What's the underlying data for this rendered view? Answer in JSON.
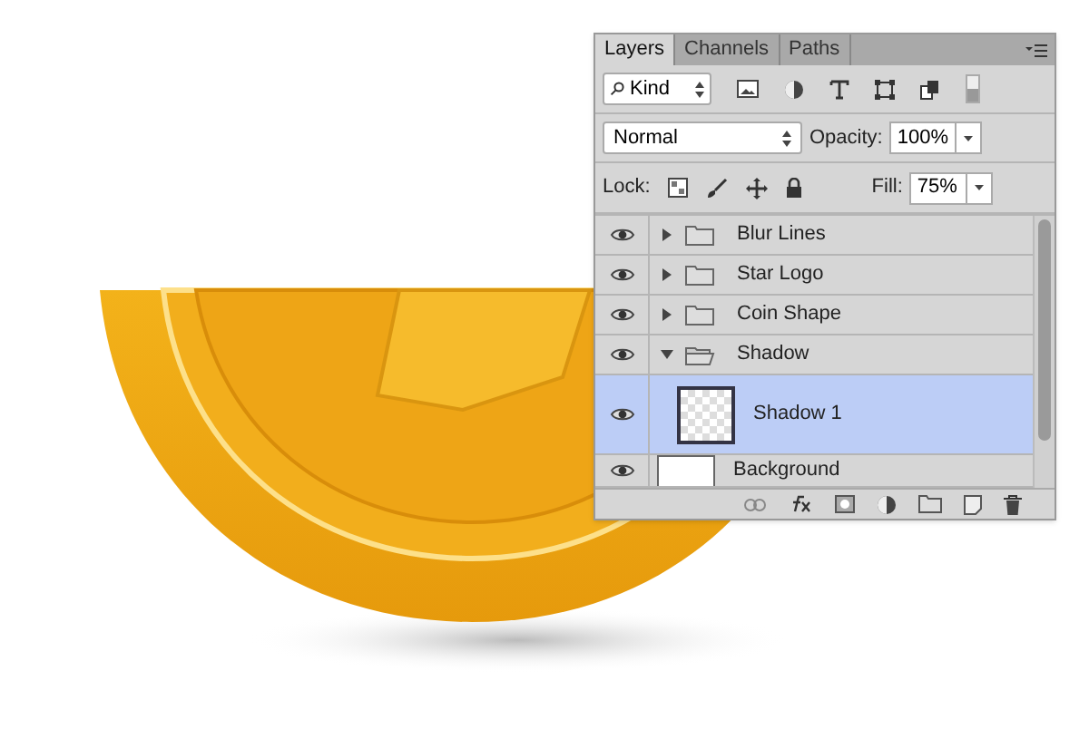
{
  "panel": {
    "tabs": [
      {
        "label": "Layers",
        "selected": true
      },
      {
        "label": "Channels",
        "selected": false
      },
      {
        "label": "Paths",
        "selected": false
      }
    ],
    "filter": {
      "value": "Kind"
    },
    "blend_mode": {
      "value": "Normal"
    },
    "opacity": {
      "label": "Opacity:",
      "value": "100%"
    },
    "lock": {
      "label": "Lock:"
    },
    "fill": {
      "label": "Fill:",
      "value": "75%"
    },
    "layers": [
      {
        "name": "Blur Lines",
        "kind": "group",
        "visible": true,
        "expanded": false,
        "selected": false
      },
      {
        "name": "Star Logo",
        "kind": "group",
        "visible": true,
        "expanded": false,
        "selected": false
      },
      {
        "name": "Coin Shape",
        "kind": "group",
        "visible": true,
        "expanded": false,
        "selected": false
      },
      {
        "name": "Shadow",
        "kind": "group",
        "visible": true,
        "expanded": true,
        "selected": false,
        "children": [
          {
            "name": "Shadow 1",
            "kind": "layer",
            "visible": true,
            "selected": true
          }
        ]
      },
      {
        "name": "Background",
        "kind": "background",
        "visible": true,
        "selected": false
      }
    ]
  }
}
